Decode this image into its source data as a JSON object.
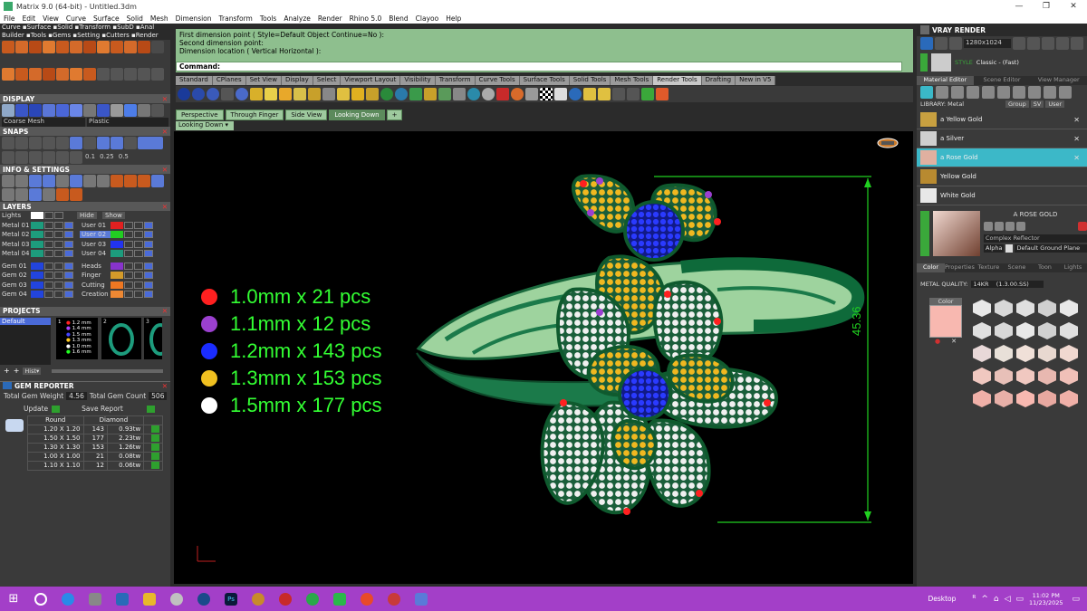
{
  "window": {
    "title": "Matrix 9.0 (64-bit) - Untitled.3dm",
    "min": "—",
    "restore": "❐",
    "close": "✕"
  },
  "menu": [
    "File",
    "Edit",
    "View",
    "Curve",
    "Surface",
    "Solid",
    "Mesh",
    "Dimension",
    "Transform",
    "Tools",
    "Analyze",
    "Render",
    "Rhino 5.0",
    "Blend",
    "Clayoo",
    "Help"
  ],
  "left_toolbar_tabs": "Curve ▪Surface ▪Solid ▪Transform ▪SubD ▪Anal",
  "left_toolbar_tabs2": "Builder ▪Tools ▪Gems ▪Setting ▪Cutters ▪Render",
  "display": {
    "title": "DISPLAY",
    "mesh": "Coarse Mesh",
    "material": "Plastic"
  },
  "snaps": {
    "title": "SNAPS",
    "vals": [
      "0.1",
      "0.25",
      "0.5"
    ]
  },
  "info": {
    "title": "INFO & SETTINGS"
  },
  "layers": {
    "title": "LAYERS",
    "lights": "Lights",
    "hide": "Hide",
    "show": "Show",
    "left": [
      {
        "name": "Metal 01",
        "color": "#1d9c7d"
      },
      {
        "name": "Metal 02",
        "color": "#1d9c7d"
      },
      {
        "name": "Metal 03",
        "color": "#1d9c7d"
      },
      {
        "name": "Metal 04",
        "color": "#1d9c7d"
      },
      {
        "name": "Gem 01",
        "color": "#2244dd"
      },
      {
        "name": "Gem 02",
        "color": "#2244dd"
      },
      {
        "name": "Gem 03",
        "color": "#2244dd"
      },
      {
        "name": "Gem 04",
        "color": "#2244dd"
      }
    ],
    "right": [
      {
        "name": "User 01",
        "color": "#e02020"
      },
      {
        "name": "User 02",
        "color": "#22cc22"
      },
      {
        "name": "User 03",
        "color": "#2233ee"
      },
      {
        "name": "User 04",
        "color": "#1d9c7d"
      },
      {
        "name": "Heads",
        "color": "#8833cc"
      },
      {
        "name": "Finger",
        "color": "#d49b2a"
      },
      {
        "name": "Cutting",
        "color": "#ee7722"
      },
      {
        "name": "Creation",
        "color": "#ee8833"
      }
    ]
  },
  "projects": {
    "title": "PROJECTS",
    "item": "Default",
    "hist": "Hist▾",
    "gems": [
      "1.2 mm",
      "1.4 mm",
      "1.5 mm",
      "1.3 mm",
      "1.0 mm",
      "1.6 mm"
    ],
    "thumbs": [
      "1",
      "2",
      "3"
    ]
  },
  "gem_reporter": {
    "title": "GEM REPORTER",
    "weight_label": "Total Gem Weight",
    "weight": "4.56",
    "count_label": "Total Gem Count",
    "count": "506",
    "update": "Update",
    "save": "Save Report",
    "col1": "Round",
    "col2": "Diamond",
    "rows": [
      {
        "size": "1.20 X 1.20",
        "qty": "143",
        "ct": "0.93tw"
      },
      {
        "size": "1.50 X 1.50",
        "qty": "177",
        "ct": "2.23tw"
      },
      {
        "size": "1.30 X 1.30",
        "qty": "153",
        "ct": "1.26tw"
      },
      {
        "size": "1.00 X 1.00",
        "qty": "21",
        "ct": "0.08tw"
      },
      {
        "size": "1.10 X 1.10",
        "qty": "12",
        "ct": "0.06tw"
      }
    ]
  },
  "command": {
    "lines": [
      "First dimension point ( Style=Default  Object  Continue=No ):",
      "Second dimension point:",
      "Dimension location ( Vertical  Horizontal ):"
    ],
    "label": "Command:"
  },
  "tabs": [
    "Standard",
    "CPlanes",
    "Set View",
    "Display",
    "Select",
    "Viewport Layout",
    "Visibility",
    "Transform",
    "Curve Tools",
    "Surface Tools",
    "Solid Tools",
    "Mesh Tools",
    "Render Tools",
    "Drafting",
    "New in V5"
  ],
  "viewport_tabs": [
    "Perspective",
    "Through Finger",
    "Side View",
    "Looking Down"
  ],
  "viewport_label": "Looking Down",
  "dimension": "45.36",
  "legend": [
    {
      "text": "1.0mm x 21 pcs",
      "color": "#ff2020"
    },
    {
      "text": "1.1mm x 12 pcs",
      "color": "#9b40d0"
    },
    {
      "text": "1.2mm x 143 pcs",
      "color": "#1a2cff"
    },
    {
      "text": "1.3mm x 153 pcs",
      "color": "#f0c020"
    },
    {
      "text": "1.5mm x 177 pcs",
      "color": "#ffffff"
    }
  ],
  "vray": {
    "title": "VRAY RENDER",
    "resolution": "1280x1024",
    "style_label": "STYLE",
    "style": "Classic - (Fast)",
    "tabs": [
      "Material Editor",
      "Scene Editor",
      "View Manager"
    ],
    "library": "LIBRARY: Metal",
    "group": "Group",
    "sv": "SV",
    "user": "User",
    "items": [
      {
        "name": "a Yellow Gold",
        "color": "#c8a040",
        "close": "✕"
      },
      {
        "name": "a Silver",
        "color": "#cfcfcf",
        "close": "✕"
      },
      {
        "name": "a Rose Gold",
        "color": "#e0b0a0",
        "close": "✕"
      },
      {
        "name": "Yellow Gold",
        "color": "#b88a30",
        "close": ""
      },
      {
        "name": "White Gold",
        "color": "#e8e8e8",
        "close": ""
      }
    ],
    "selected_name": "A ROSE GOLD",
    "reflector": "Complex Reflector",
    "alpha": "Alpha",
    "ground": "Default Ground Plane",
    "subtabs": [
      "Color",
      "Properties",
      "Texture",
      "Scene",
      "Toon",
      "Lights"
    ],
    "metal_quality_label": "METAL QUALITY:",
    "metal_quality": "14KR",
    "metal_quality_extra": "(1.3.00.SS)",
    "color_label": "Color",
    "swatch": "#f8b8b0"
  },
  "taskbar": {
    "desktop": "Desktop",
    "time": "11:02 PM",
    "date": "11/23/2025"
  }
}
